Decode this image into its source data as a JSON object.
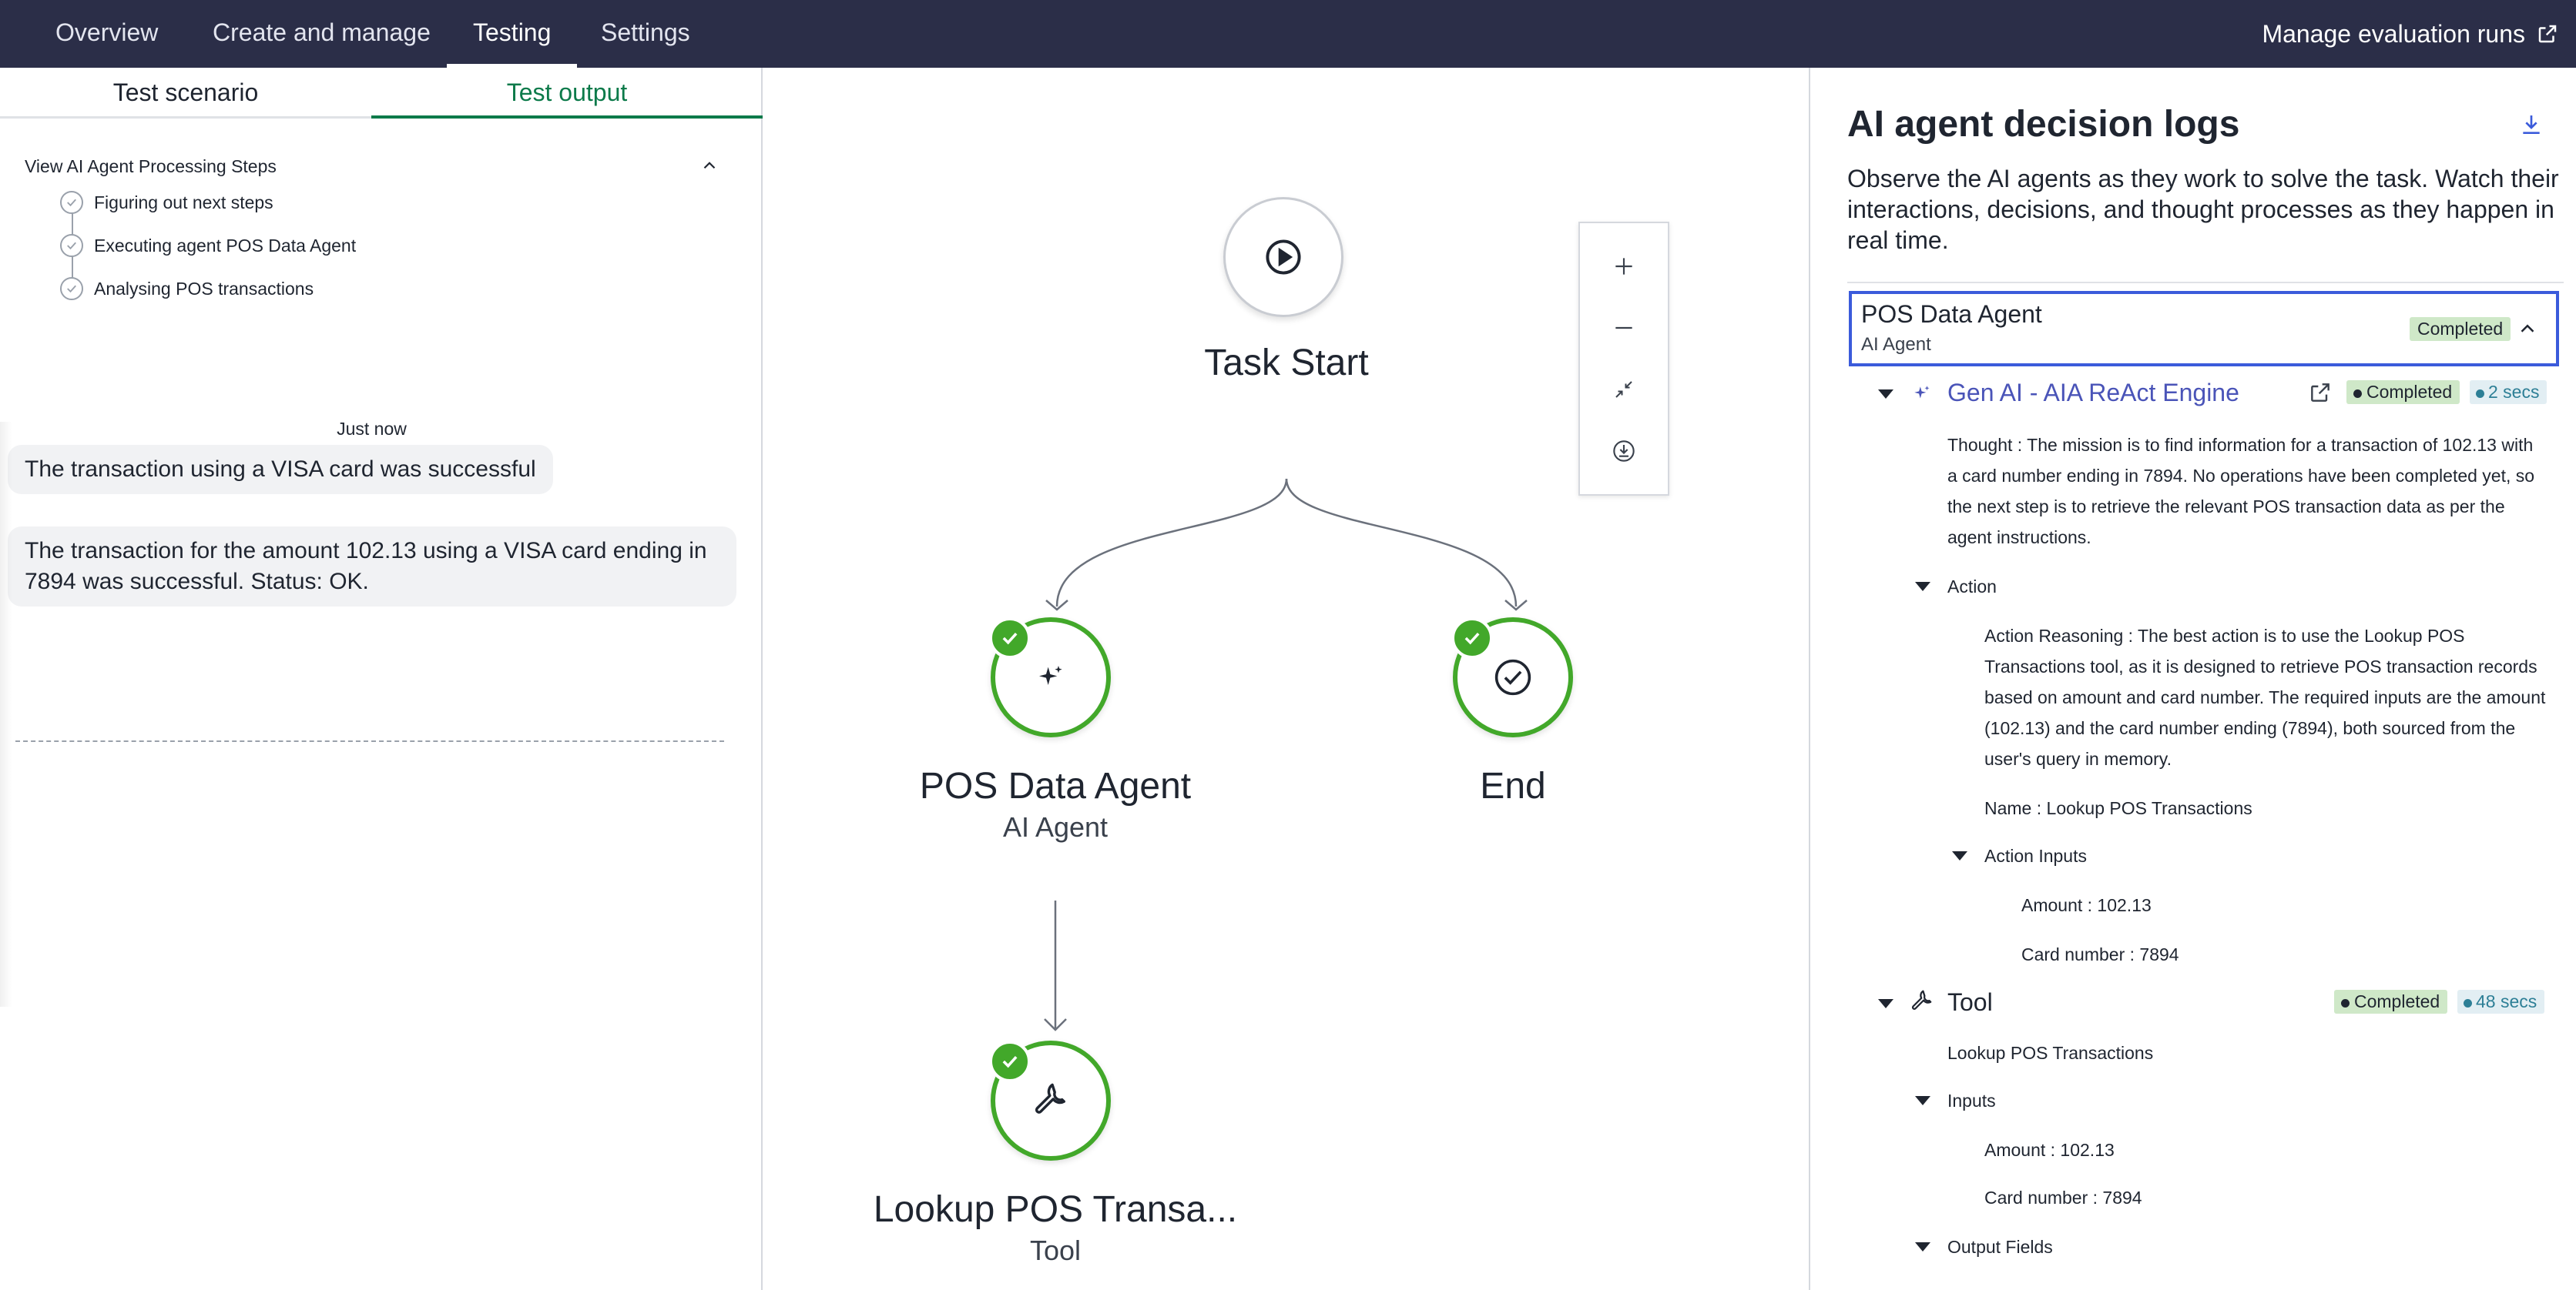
{
  "nav": {
    "tabs": [
      "Overview",
      "Create and manage",
      "Testing",
      "Settings"
    ],
    "active_tab": "Testing",
    "manage_link": "Manage evaluation runs"
  },
  "left": {
    "tabs": [
      "Test scenario",
      "Test output"
    ],
    "active_tab": "Test output",
    "steps_title": "View AI Agent Processing Steps",
    "steps": [
      "Figuring out next steps",
      "Executing agent POS Data Agent",
      "Analysing POS transactions"
    ],
    "timestamp": "Just now",
    "messages": [
      "The transaction using a VISA card was successful",
      "The transaction for the amount 102.13 using a VISA card ending in 7894 was successful. Status: OK."
    ]
  },
  "canvas": {
    "nodes": {
      "start": {
        "title": "Task Start"
      },
      "agent": {
        "title": "POS Data Agent",
        "subtitle": "AI Agent"
      },
      "end": {
        "title": "End"
      },
      "tool": {
        "title": "Lookup POS Transa...",
        "subtitle": "Tool"
      }
    }
  },
  "logs": {
    "title": "AI agent decision logs",
    "description": "Observe the AI agents as they work to solve the task. Watch their interactions, decisions, and thought processes as they happen in real time.",
    "agent": {
      "name": "POS Data Agent",
      "type": "AI Agent",
      "status": "Completed"
    },
    "engine": {
      "name": "Gen AI - AIA ReAct Engine",
      "status": "Completed",
      "duration": "2 secs",
      "thought": "Thought : The mission is to find information for a transaction of 102.13 with a card number ending in 7894. No operations have been completed yet, so the next step is to retrieve the relevant POS transaction data as per the agent instructions.",
      "action_label": "Action",
      "action_reasoning": "Action Reasoning : The best action is to use the Lookup POS Transactions tool, as it is designed to retrieve POS transaction records based on amount and card number. The required inputs are the amount (102.13) and the card number ending (7894), both sourced from the user's query in memory.",
      "action_name": "Name : Lookup POS Transactions",
      "inputs_label": "Action Inputs",
      "inputs": [
        "Amount : 102.13",
        "Card number : 7894"
      ]
    },
    "tool": {
      "name": "Tool",
      "status": "Completed",
      "duration": "48 secs",
      "tool_name": "Lookup POS Transactions",
      "inputs_label": "Inputs",
      "inputs": [
        "Amount : 102.13",
        "Card number : 7894"
      ],
      "output_label": "Output Fields"
    }
  },
  "colors": {
    "nav_bg": "#2b2e48",
    "accent_green": "#0c7a4a",
    "success": "#42a82a",
    "focus_blue": "#3b5bdb",
    "engine_text": "#4a54b8"
  }
}
